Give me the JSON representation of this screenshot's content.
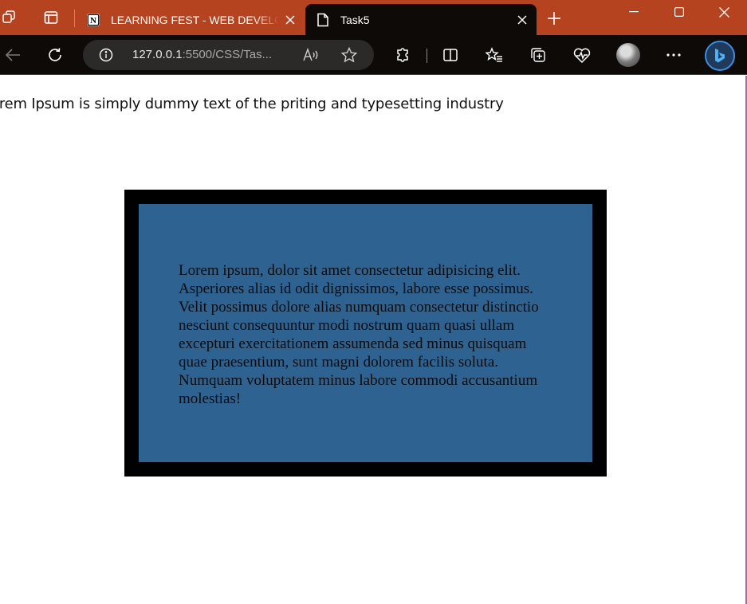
{
  "browser": {
    "tabs": [
      {
        "title": "LEARNING FEST - WEB DEVELOPMENT",
        "favicon": "notion-icon",
        "active": false
      },
      {
        "title": "Task5",
        "favicon": "page-icon",
        "active": true
      }
    ],
    "address": {
      "host": "127.0.0.1",
      "path": ":5500/CSS/Tas..."
    },
    "colors": {
      "tabstrip": "#b6431f",
      "toolbar": "#0e0a07",
      "addressbar": "#2c2a29"
    }
  },
  "page": {
    "intro": "orem Ipsum is simply dummy text of the priting and typesetting industry",
    "box_text": "Lorem ipsum, dolor sit amet consectetur adipisicing elit. Asperiores alias id odit dignissimos, labore esse possimus. Velit possimus dolore alias numquam consectetur distinctio nesciunt consequuntur modi nostrum quam quasi ullam excepturi exercitationem assumenda sed minus quisquam quae praesentium, sunt magni dolorem facilis soluta. Numquam voluptatem minus labore commodi accusantium molestias!",
    "colors": {
      "box_border": "#000000",
      "box_fill": "#2d6291"
    }
  }
}
